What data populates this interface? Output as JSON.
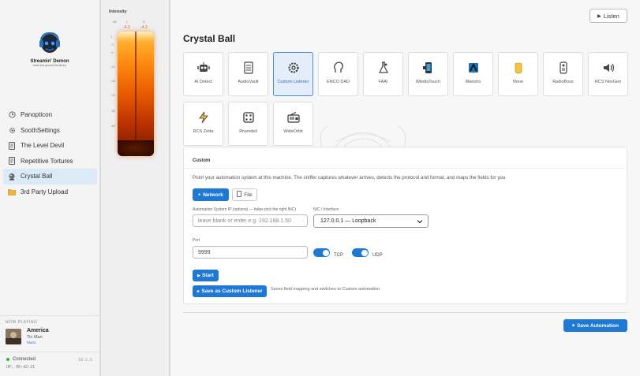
{
  "app": {
    "logo_title": "Streamin' Demon",
    "logo_subtitle": "tools that ground the library"
  },
  "sidebar": {
    "items": [
      {
        "label": "Panopticon",
        "icon": "clock-icon",
        "active": false
      },
      {
        "label": "SoothSettings",
        "icon": "gear-icon",
        "active": false
      },
      {
        "label": "The Level Devil",
        "icon": "document-icon",
        "active": false
      },
      {
        "label": "Repetitive Tortures",
        "icon": "document-icon",
        "active": false
      },
      {
        "label": "Crystal Ball",
        "icon": "crystal-ball-icon",
        "active": true
      },
      {
        "label": "3rd Party Upload",
        "icon": "folder-icon",
        "active": false
      }
    ]
  },
  "now_playing": {
    "heading": "NOW PLAYING",
    "title": "America",
    "artist": "Tin Man",
    "tag": "Music"
  },
  "status": {
    "connection": "Connected",
    "version": "10.2.5",
    "uptime": "UP: 00:42:21"
  },
  "meter": {
    "label": "Intensity",
    "channels": [
      "L",
      "R"
    ],
    "peaks": [
      "-4.3",
      "-4.3"
    ],
    "ticks": [
      "0",
      "-3",
      "-6",
      "-12",
      "-18",
      "-24",
      "-36",
      "-48"
    ]
  },
  "main": {
    "listen_label": "Listen",
    "title": "Crystal Ball",
    "tiles": [
      {
        "label": "AI Detect",
        "icon": "robot-icon",
        "selected": false
      },
      {
        "label": "AudioVault",
        "icon": "server-icon",
        "selected": false
      },
      {
        "label": "Custom Listener",
        "icon": "gear-icon",
        "selected": true
      },
      {
        "label": "ENCO DAD",
        "icon": "head-icon",
        "selected": false
      },
      {
        "label": "FAAI",
        "icon": "lab-icon",
        "selected": false
      },
      {
        "label": "iMediaTouch",
        "icon": "phone-icon",
        "selected": false
      },
      {
        "label": "Maestro",
        "icon": "maestro-icon",
        "selected": false
      },
      {
        "label": "None",
        "icon": "hand-icon",
        "selected": false
      },
      {
        "label": "RadioBoss",
        "icon": "remote-icon",
        "selected": false
      },
      {
        "label": "RCS NexGen",
        "icon": "speaker-icon",
        "selected": false
      },
      {
        "label": "RCS Zetta",
        "icon": "lightning-icon",
        "selected": false
      },
      {
        "label": "Rivendell",
        "icon": "dice-icon",
        "selected": false
      },
      {
        "label": "WideOrbit",
        "icon": "radio-icon",
        "selected": false
      }
    ],
    "custom": {
      "heading": "Custom",
      "description": "Point your automation system at this machine. The sniffer captures whatever arrives, detects the protocol and format, and maps the fields for you.",
      "network_label": "Network",
      "file_label": "File",
      "ip_label": "Automation System IP (optional — helps pick the right NIC)",
      "ip_placeholder": "leave blank or enter e.g. 192.168.1.50",
      "nic_label": "NIC / Interface",
      "nic_value": "127.0.0.1 — Loopback",
      "port_label": "Port",
      "port_value": "9999",
      "tcp_label": "TCP",
      "udp_label": "UDP",
      "tcp_on": true,
      "udp_on": true,
      "start_label": "Start",
      "save_listener_label": "Save as Custom Listener",
      "save_hint": "Saves field mapping and switches to Custom automation"
    },
    "save_automation_label": "Save Automation"
  },
  "colors": {
    "accent": "#1e78d4",
    "selected_tile_bg": "#e4eefb",
    "active_nav_bg": "#dce9f7",
    "meter_hot": "#ff8a10"
  }
}
